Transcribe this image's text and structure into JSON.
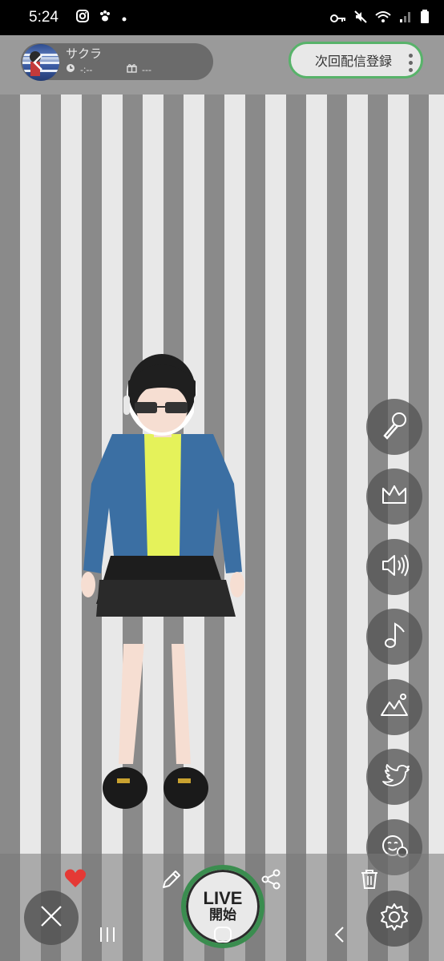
{
  "status_bar": {
    "time": "5:24",
    "icons": [
      "instagram-icon",
      "paw-icon",
      "dot-icon",
      "key-icon",
      "mute-icon",
      "wifi-icon",
      "signal-icon",
      "battery-icon"
    ]
  },
  "profile": {
    "name": "サクラ",
    "time_value": "-:--",
    "gift_value": "---"
  },
  "reserve_button": {
    "label": "次回配信登録"
  },
  "side_buttons": [
    "microphone-icon",
    "crown-icon",
    "speaker-icon",
    "music-note-icon",
    "background-image-icon",
    "twitter-icon",
    "emotion-icon"
  ],
  "live_button": {
    "label": "LIVE",
    "sub_label": "開始"
  },
  "colors": {
    "accent_green": "#58b36a",
    "live_ring": "#3a8d4f",
    "heart": "#e53935"
  }
}
